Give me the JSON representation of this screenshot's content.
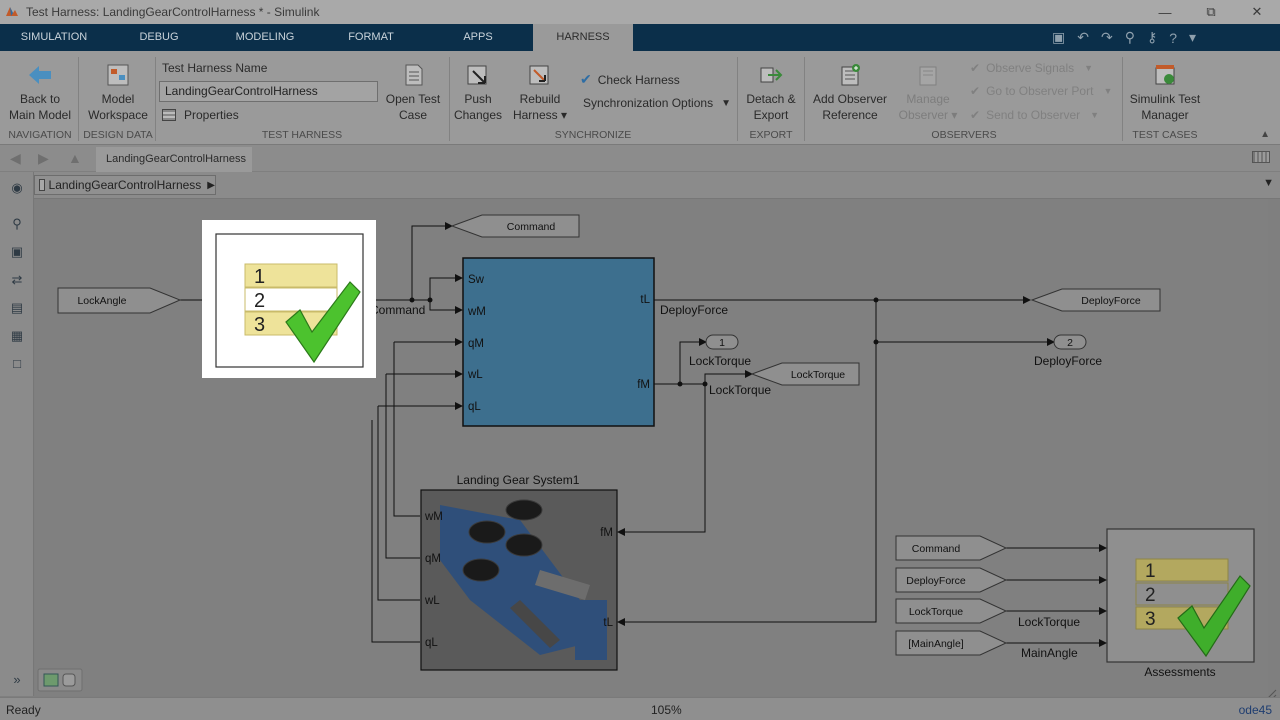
{
  "window": {
    "title": "Test Harness: LandingGearControlHarness * - Simulink"
  },
  "tabs": [
    {
      "label": "SIMULATION"
    },
    {
      "label": "DEBUG"
    },
    {
      "label": "MODELING"
    },
    {
      "label": "FORMAT"
    },
    {
      "label": "APPS"
    },
    {
      "label": "HARNESS"
    }
  ],
  "ribbon": {
    "back": "Back to Main Model",
    "back_l1": "Back to",
    "back_l2": "Main Model",
    "mw_l1": "Model",
    "mw_l2": "Workspace",
    "harness_name_label": "Test Harness Name",
    "harness_name_value": "LandingGearControlHarness",
    "properties": "Properties",
    "open_l1": "Open Test",
    "open_l2": "Case",
    "push_l1": "Push",
    "push_l2": "Changes",
    "rebuild_l1": "Rebuild",
    "rebuild_l2": "Harness",
    "check_harness": "Check Harness",
    "sync_options": "Synchronization Options",
    "detach_l1": "Detach &",
    "detach_l2": "Export",
    "addobs_l1": "Add Observer",
    "addobs_l2": "Reference",
    "manage_l1": "Manage",
    "manage_l2": "Observer",
    "observe_signals": "Observe Signals",
    "goto_observer": "Go to Observer Port",
    "send_observer": "Send to Observer",
    "stm_l1": "Simulink Test",
    "stm_l2": "Manager",
    "groups": {
      "navigation": "NAVIGATION",
      "design_data": "DESIGN DATA",
      "test_harness": "TEST HARNESS",
      "synchronize": "SYNCHRONIZE",
      "export": "EXPORT",
      "observers": "OBSERVERS",
      "test_cases": "TEST CASES"
    }
  },
  "editor": {
    "doc_tab": "LandingGearControlHarness",
    "breadcrumb": "LandingGearControlHarness"
  },
  "diagram": {
    "lockangle": "LockAngle",
    "command_tag": "Command",
    "command_sig": "Command",
    "ctrl_ports_in": [
      "Sw",
      "wM",
      "qM",
      "wL",
      "qL"
    ],
    "ctrl_port_tl": "tL",
    "ctrl_port_fm": "fM",
    "deployforce_sig": "DeployForce",
    "deployforce_tag": "DeployForce",
    "out1_num": "1",
    "out1_label": "LockTorque",
    "out2_num": "2",
    "out2_label": "DeployForce",
    "locktorque_sig": "LockTorque",
    "locktorque_tag": "LockTorque",
    "lgs_title": "Landing Gear System1",
    "lgs_ports": [
      "wM",
      "qM",
      "wL",
      "qL"
    ],
    "lgs_port_fm": "fM",
    "lgs_port_tl": "tL",
    "from_tags": [
      "Command",
      "DeployForce",
      "LockTorque",
      "[MainAngle]"
    ],
    "sig_locktorque": "LockTorque",
    "sig_mainangle": "MainAngle",
    "assessments": "Assessments",
    "list_items": [
      "1",
      "2",
      "3"
    ]
  },
  "status": {
    "left": "Ready",
    "zoom": "105%",
    "solver": "ode45"
  },
  "colors": {
    "ribbon_bg": "#9a9a9a",
    "tabstrip_bg": "#0b2f4a",
    "canvas_bg": "#808080",
    "controller_block": "#3d6f8e",
    "check_green": "#3fae2b",
    "list_yellow": "#e6d67a"
  }
}
